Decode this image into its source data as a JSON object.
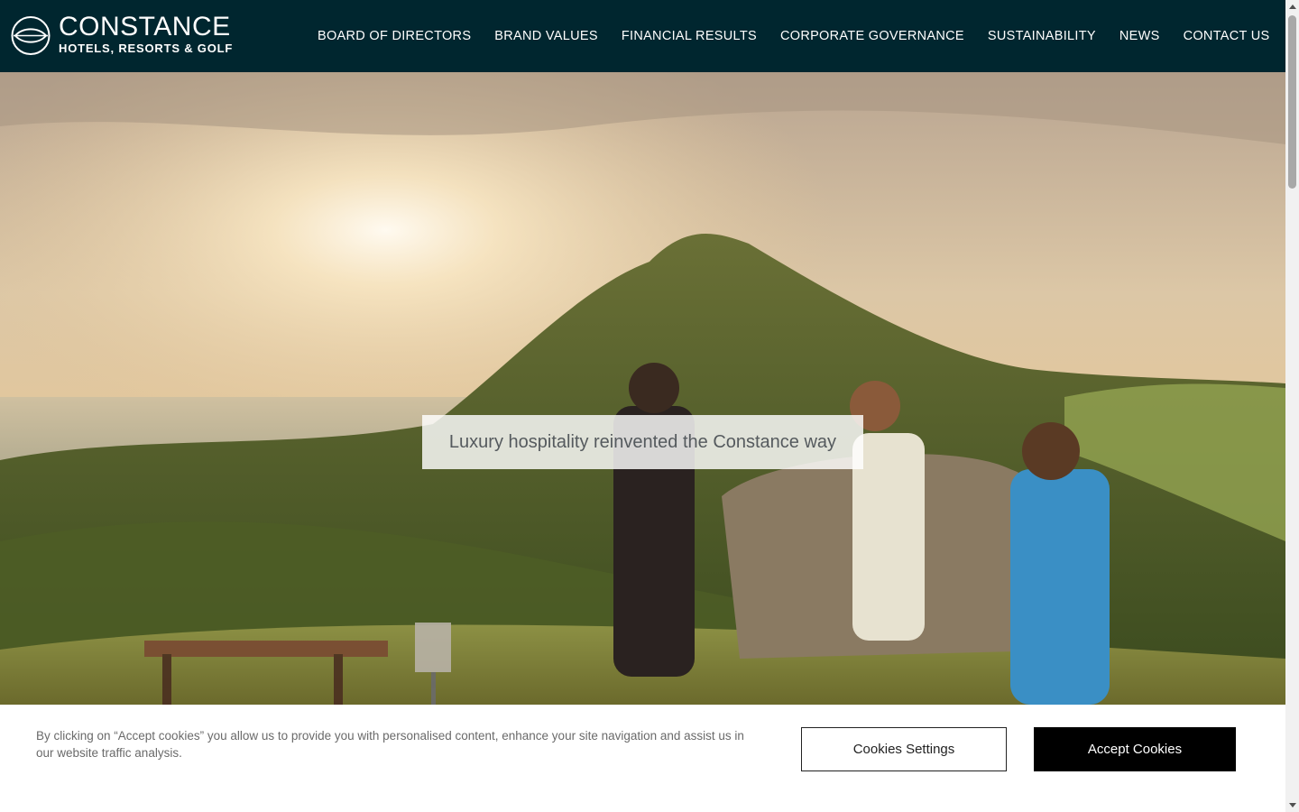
{
  "logo": {
    "name": "CONSTANCE",
    "subtitle": "HOTELS, RESORTS & GOLF"
  },
  "nav": {
    "items": [
      {
        "label": "BOARD OF DIRECTORS"
      },
      {
        "label": "BRAND VALUES"
      },
      {
        "label": "FINANCIAL RESULTS"
      },
      {
        "label": "CORPORATE GOVERNANCE"
      },
      {
        "label": "SUSTAINABILITY"
      },
      {
        "label": "NEWS"
      },
      {
        "label": "CONTACT US"
      }
    ]
  },
  "hero": {
    "tagline": "Luxury hospitality reinvented the Constance way"
  },
  "cookie_banner": {
    "text": "By clicking on “Accept cookies” you allow us to provide you with personalised content, enhance your site navigation and assist us in our website traffic analysis.",
    "settings_label": "Cookies Settings",
    "accept_label": "Accept Cookies"
  },
  "colors": {
    "header_bg": "#00262f",
    "accept_bg": "#000000"
  }
}
